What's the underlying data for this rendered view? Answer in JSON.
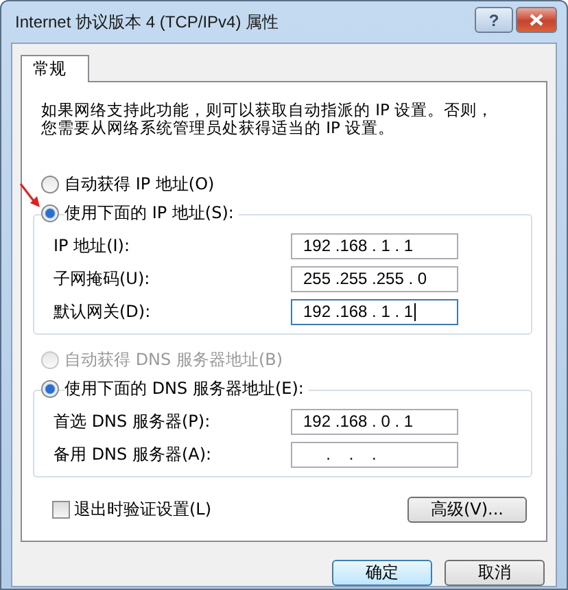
{
  "window": {
    "title": "Internet 协议版本 4 (TCP/IPv4) 属性",
    "help": "?"
  },
  "tabs": [
    {
      "label": "常规",
      "selected": true
    }
  ],
  "intro": "如果网络支持此功能，则可以获取自动指派的 IP 设置。否则，您需要从网络系统管理员处获得适当的 IP 设置。",
  "ip_section": {
    "options": [
      {
        "label": "自动获得 IP 地址(O)",
        "selected": false,
        "disabled": false
      },
      {
        "label": "使用下面的 IP 地址(S):",
        "selected": true,
        "disabled": false
      }
    ],
    "fields": [
      {
        "label": "IP 地址(I):",
        "value": "192 .168 . 1 . 1",
        "focused": false
      },
      {
        "label": "子网掩码(U):",
        "value": "255 .255 .255 . 0",
        "focused": false
      },
      {
        "label": "默认网关(D):",
        "value": "192 .168 . 1 . 1",
        "focused": true
      }
    ]
  },
  "dns_section": {
    "options": [
      {
        "label": "自动获得 DNS 服务器地址(B)",
        "selected": false,
        "disabled": true
      },
      {
        "label": "使用下面的 DNS 服务器地址(E):",
        "selected": true,
        "disabled": false
      }
    ],
    "fields": [
      {
        "label": "首选 DNS 服务器(P):",
        "value": "192 .168 . 0 . 1",
        "focused": false
      },
      {
        "label": "备用 DNS 服务器(A):",
        "value": "     .    .    .",
        "focused": false
      }
    ]
  },
  "validate_checkbox": {
    "label": "退出时验证设置(L)",
    "checked": false
  },
  "advanced_button": "高级(V)...",
  "buttons": [
    {
      "label": "确定",
      "default": true
    },
    {
      "label": "取消",
      "default": false
    }
  ]
}
